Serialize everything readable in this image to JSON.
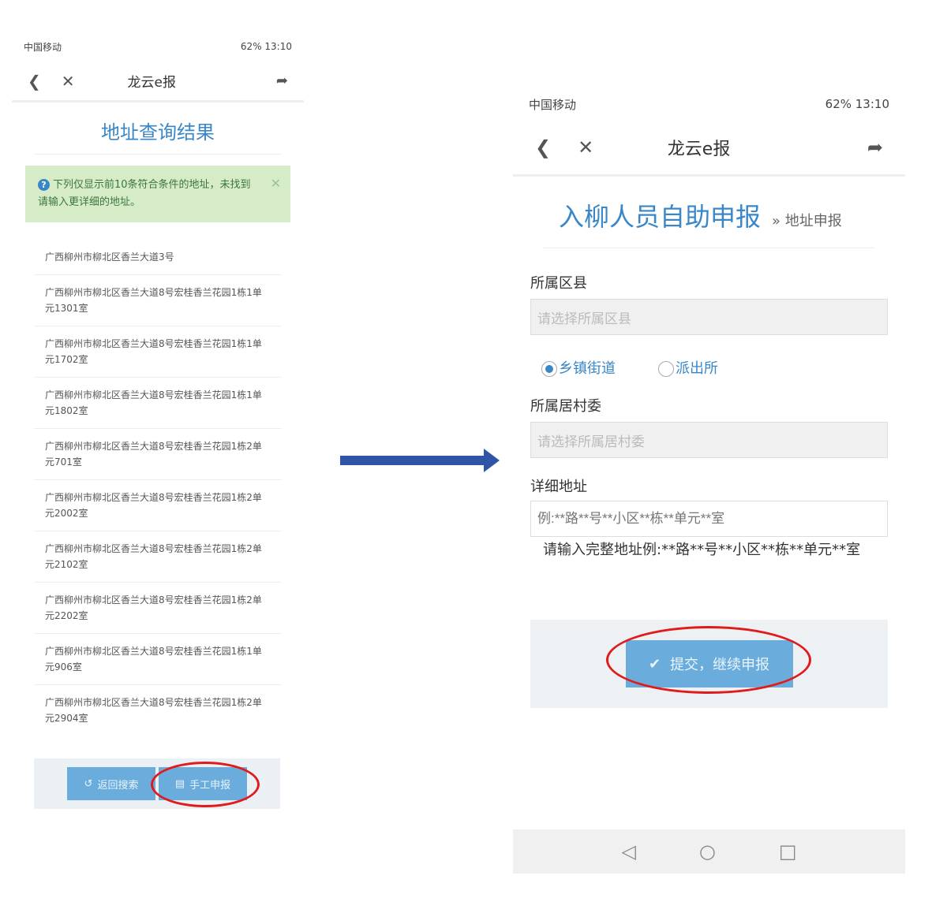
{
  "left": {
    "status": {
      "carrier": "中国移动",
      "right": "62% 13:10"
    },
    "nav": {
      "title": "龙云e报"
    },
    "heading": "地址查询结果",
    "alert": "下列仅显示前10条符合条件的地址，未找到请输入更详细的地址。",
    "items": [
      "广西柳州市柳北区香兰大道3号",
      "广西柳州市柳北区香兰大道8号宏桂香兰花园1栋1单元1301室",
      "广西柳州市柳北区香兰大道8号宏桂香兰花园1栋1单元1702室",
      "广西柳州市柳北区香兰大道8号宏桂香兰花园1栋1单元1802室",
      "广西柳州市柳北区香兰大道8号宏桂香兰花园1栋2单元701室",
      "广西柳州市柳北区香兰大道8号宏桂香兰花园1栋2单元2002室",
      "广西柳州市柳北区香兰大道8号宏桂香兰花园1栋2单元2102室",
      "广西柳州市柳北区香兰大道8号宏桂香兰花园1栋2单元2202室",
      "广西柳州市柳北区香兰大道8号宏桂香兰花园1栋1单元906室",
      "广西柳州市柳北区香兰大道8号宏桂香兰花园1栋2单元2904室"
    ],
    "buttons": {
      "back": "返回搜索",
      "manual": "手工申报"
    }
  },
  "right": {
    "status": {
      "carrier": "中国移动",
      "right": "62% 13:10"
    },
    "nav": {
      "title": "龙云e报"
    },
    "heading": "入柳人员自助申报",
    "subheading": "» 地址申报",
    "district_label": "所属区县",
    "district_placeholder": "请选择所属区县",
    "radio_town": "乡镇街道",
    "radio_police": "派出所",
    "committee_label": "所属居村委",
    "committee_placeholder": "请选择所属居村委",
    "address_label": "详细地址",
    "address_placeholder": "例:**路**号**小区**栋**单元**室",
    "address_hint": "请输入完整地址例:**路**号**小区**栋**单元**室",
    "submit": "提交，继续申报"
  },
  "colors": {
    "accent": "#3a87c8",
    "button": "#6aaddc",
    "highlight": "#e01b1b",
    "arrow": "#2f55a4"
  }
}
